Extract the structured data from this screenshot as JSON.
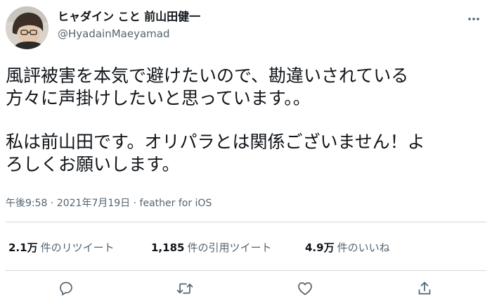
{
  "author": {
    "display_name": "ヒャダイン こと 前山田健一",
    "handle": "@HyadainMaeyamad"
  },
  "tweet": {
    "lines": [
      "風評被害を本気で避けたいので、勘違いされている",
      "方々に声掛けしたいと思っています。。",
      "私は前山田です。オリパラとは関係ございません！よ",
      "ろしくお願いします。"
    ]
  },
  "meta": {
    "time": "午後9:58",
    "separator1": "·",
    "date": "2021年7月19日",
    "separator2": "·",
    "client": "feather for iOS"
  },
  "stats": {
    "retweets": {
      "count": "2.1万",
      "label": "件のリツイート"
    },
    "quotes": {
      "count": "1,185",
      "label": "件の引用ツイート"
    },
    "likes": {
      "count": "4.9万",
      "label": "件のいいね"
    }
  },
  "icons": {
    "more": "more-dots-icon",
    "reply": "reply-icon",
    "retweet": "retweet-icon",
    "like": "heart-icon",
    "share": "share-icon"
  },
  "colors": {
    "text": "#0f1419",
    "secondary": "#536471",
    "border": "#cfd9de"
  }
}
